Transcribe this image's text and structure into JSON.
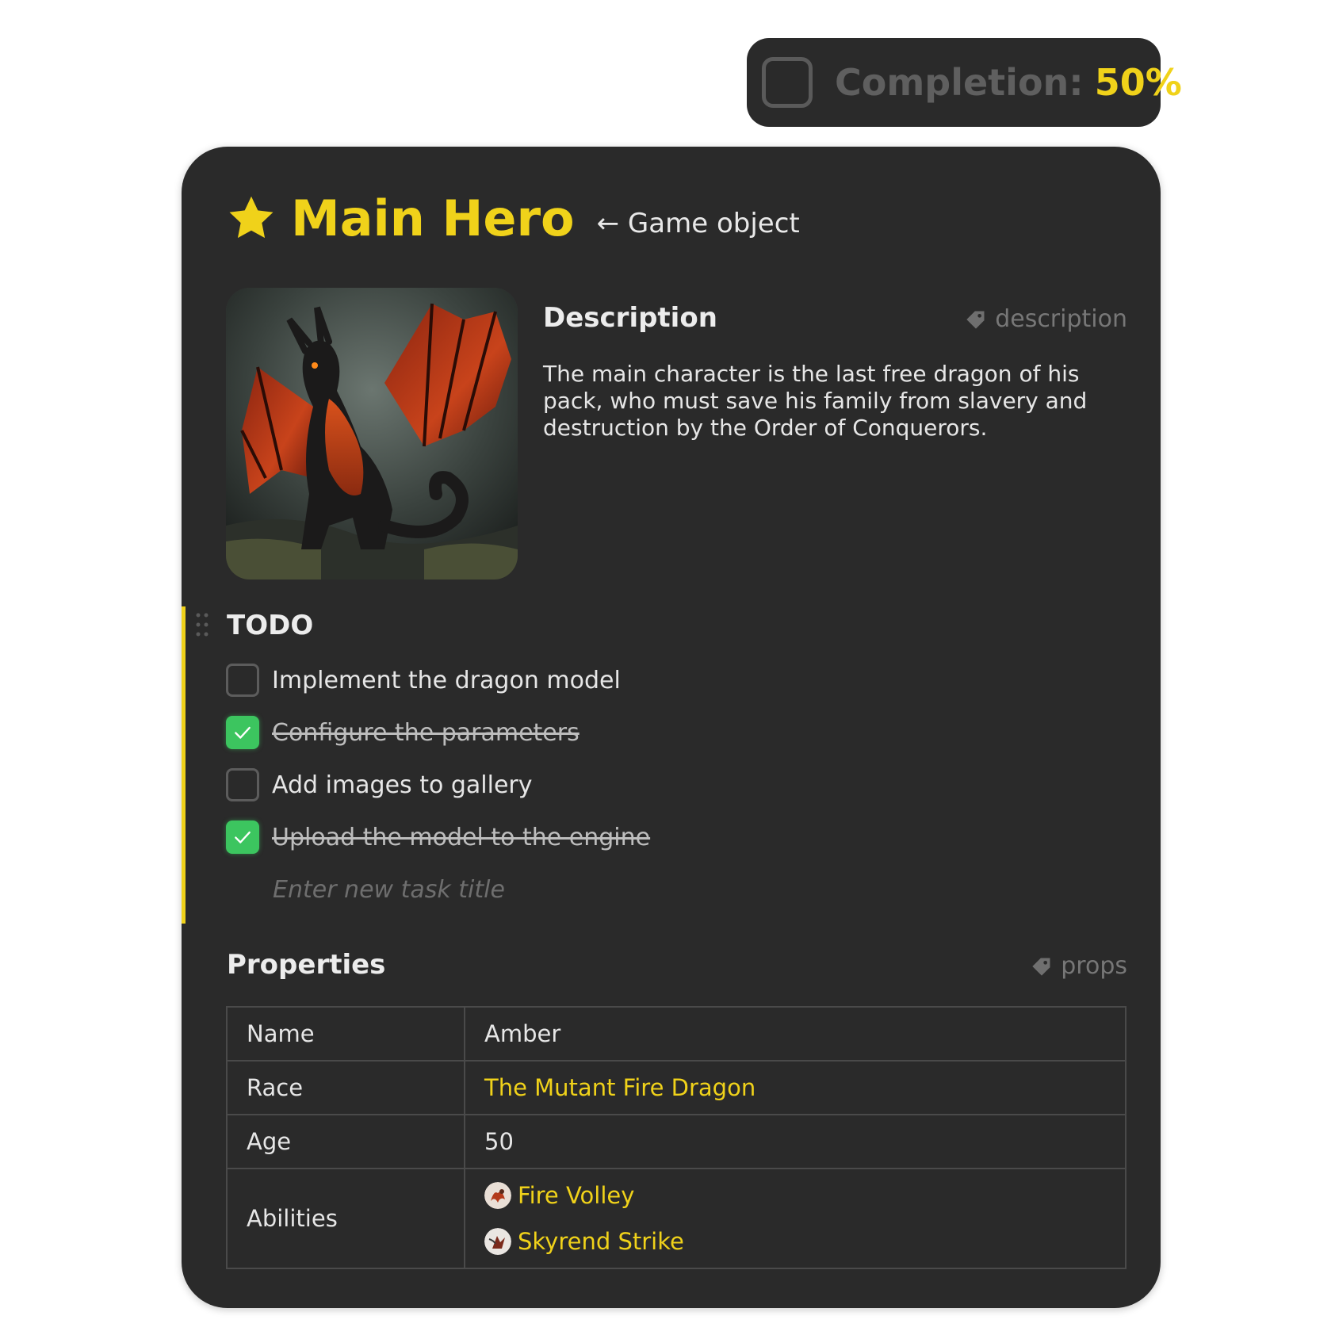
{
  "completion": {
    "label": "Completion:",
    "value": "50%"
  },
  "header": {
    "title": "Main Hero",
    "subtitle": "← Game object",
    "icon": "star-icon"
  },
  "hero_image": {
    "subject": "red-black dragon illustration"
  },
  "description": {
    "heading": "Description",
    "tag": "description",
    "text": "The main character is the last free dragon of his pack, who must save his family from slavery and destruction by the Order of Conquerors."
  },
  "todo": {
    "heading": "TODO",
    "items": [
      {
        "label": "Implement the dragon model",
        "done": false
      },
      {
        "label": "Configure the parameters",
        "done": true
      },
      {
        "label": "Add images to gallery",
        "done": false
      },
      {
        "label": "Upload the model to the engine",
        "done": true
      }
    ],
    "new_task_placeholder": "Enter new task title"
  },
  "properties": {
    "heading": "Properties",
    "tag": "props",
    "rows": [
      {
        "key": "Name",
        "value": "Amber"
      },
      {
        "key": "Race",
        "value": "The Mutant Fire Dragon"
      },
      {
        "key": "Age",
        "value": "50"
      },
      {
        "key": "Abilities",
        "values": [
          "Fire Volley",
          "Skyrend Strike"
        ]
      }
    ]
  },
  "colors": {
    "accent": "#f0d21a",
    "card_bg": "#2a2a2a",
    "check_green": "#3cc55f"
  }
}
